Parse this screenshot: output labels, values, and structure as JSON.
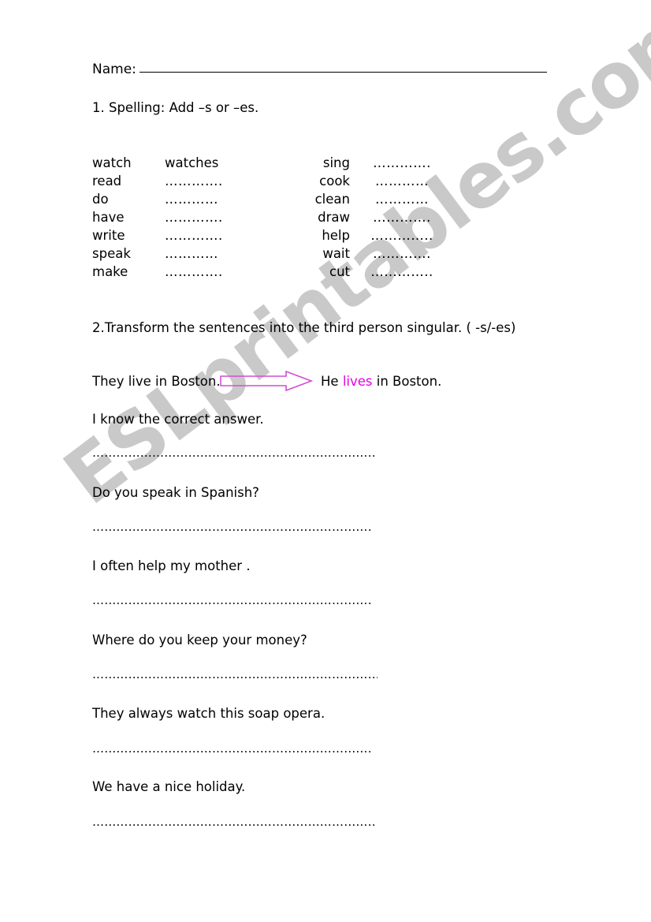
{
  "page": {
    "background_color": "#ffffff",
    "text_color": "#000000",
    "accent_color": "#e300e3",
    "watermark_color": "#c9c9c9"
  },
  "header": {
    "name_label": "Name:"
  },
  "section1": {
    "heading": "1.  Spelling: Add –s or –es.",
    "columns": [
      {
        "rows": [
          {
            "verb": "watch",
            "answer": "watches"
          },
          {
            "verb": "read",
            "answer": "…………."
          },
          {
            "verb": "do",
            "answer": "…………"
          },
          {
            "verb": "have",
            "answer": "…………."
          },
          {
            "verb": "write",
            "answer": "…………."
          },
          {
            "verb": "speak",
            "answer": "…………"
          },
          {
            "verb": "make",
            "answer": "…………."
          }
        ]
      },
      {
        "rows": [
          {
            "verb": "sing",
            "answer": "…………."
          },
          {
            "verb": "cook",
            "answer": "…………"
          },
          {
            "verb": "clean",
            "answer": "…………"
          },
          {
            "verb": "draw",
            "answer": "…………."
          },
          {
            "verb": "help",
            "answer": "………….."
          },
          {
            "verb": "wait",
            "answer": "…………."
          },
          {
            "verb": "cut",
            "answer": "………….."
          }
        ]
      }
    ]
  },
  "section2": {
    "heading": "2.Transform the sentences into the third person singular. ( -s/-es)",
    "example": {
      "prompt": "They live in Boston.",
      "arrow_icon": "right-arrow-icon",
      "answer_prefix": "He ",
      "answer_highlight": "lives",
      "answer_suffix": " in Boston."
    },
    "items": [
      {
        "sentence": "I know the correct answer.",
        "answer_line": "…………………………………………………………………………………."
      },
      {
        "sentence": "Do you speak in Spanish?",
        "answer_line": "……………………………………………………………………………….."
      },
      {
        "sentence": "I often help my mother .",
        "answer_line": "……………………………………………………………………………….."
      },
      {
        "sentence": "Where do you keep your money?",
        "answer_line": " ………………………………………………………………………………"
      },
      {
        "sentence": "They always watch this soap opera.",
        "answer_line": "……………………………………………………………………………….."
      },
      {
        "sentence": "We have a nice holiday.",
        "answer_line": "………………………………………………………………………………."
      }
    ]
  },
  "watermark": {
    "text": "ESLprintables.com"
  }
}
